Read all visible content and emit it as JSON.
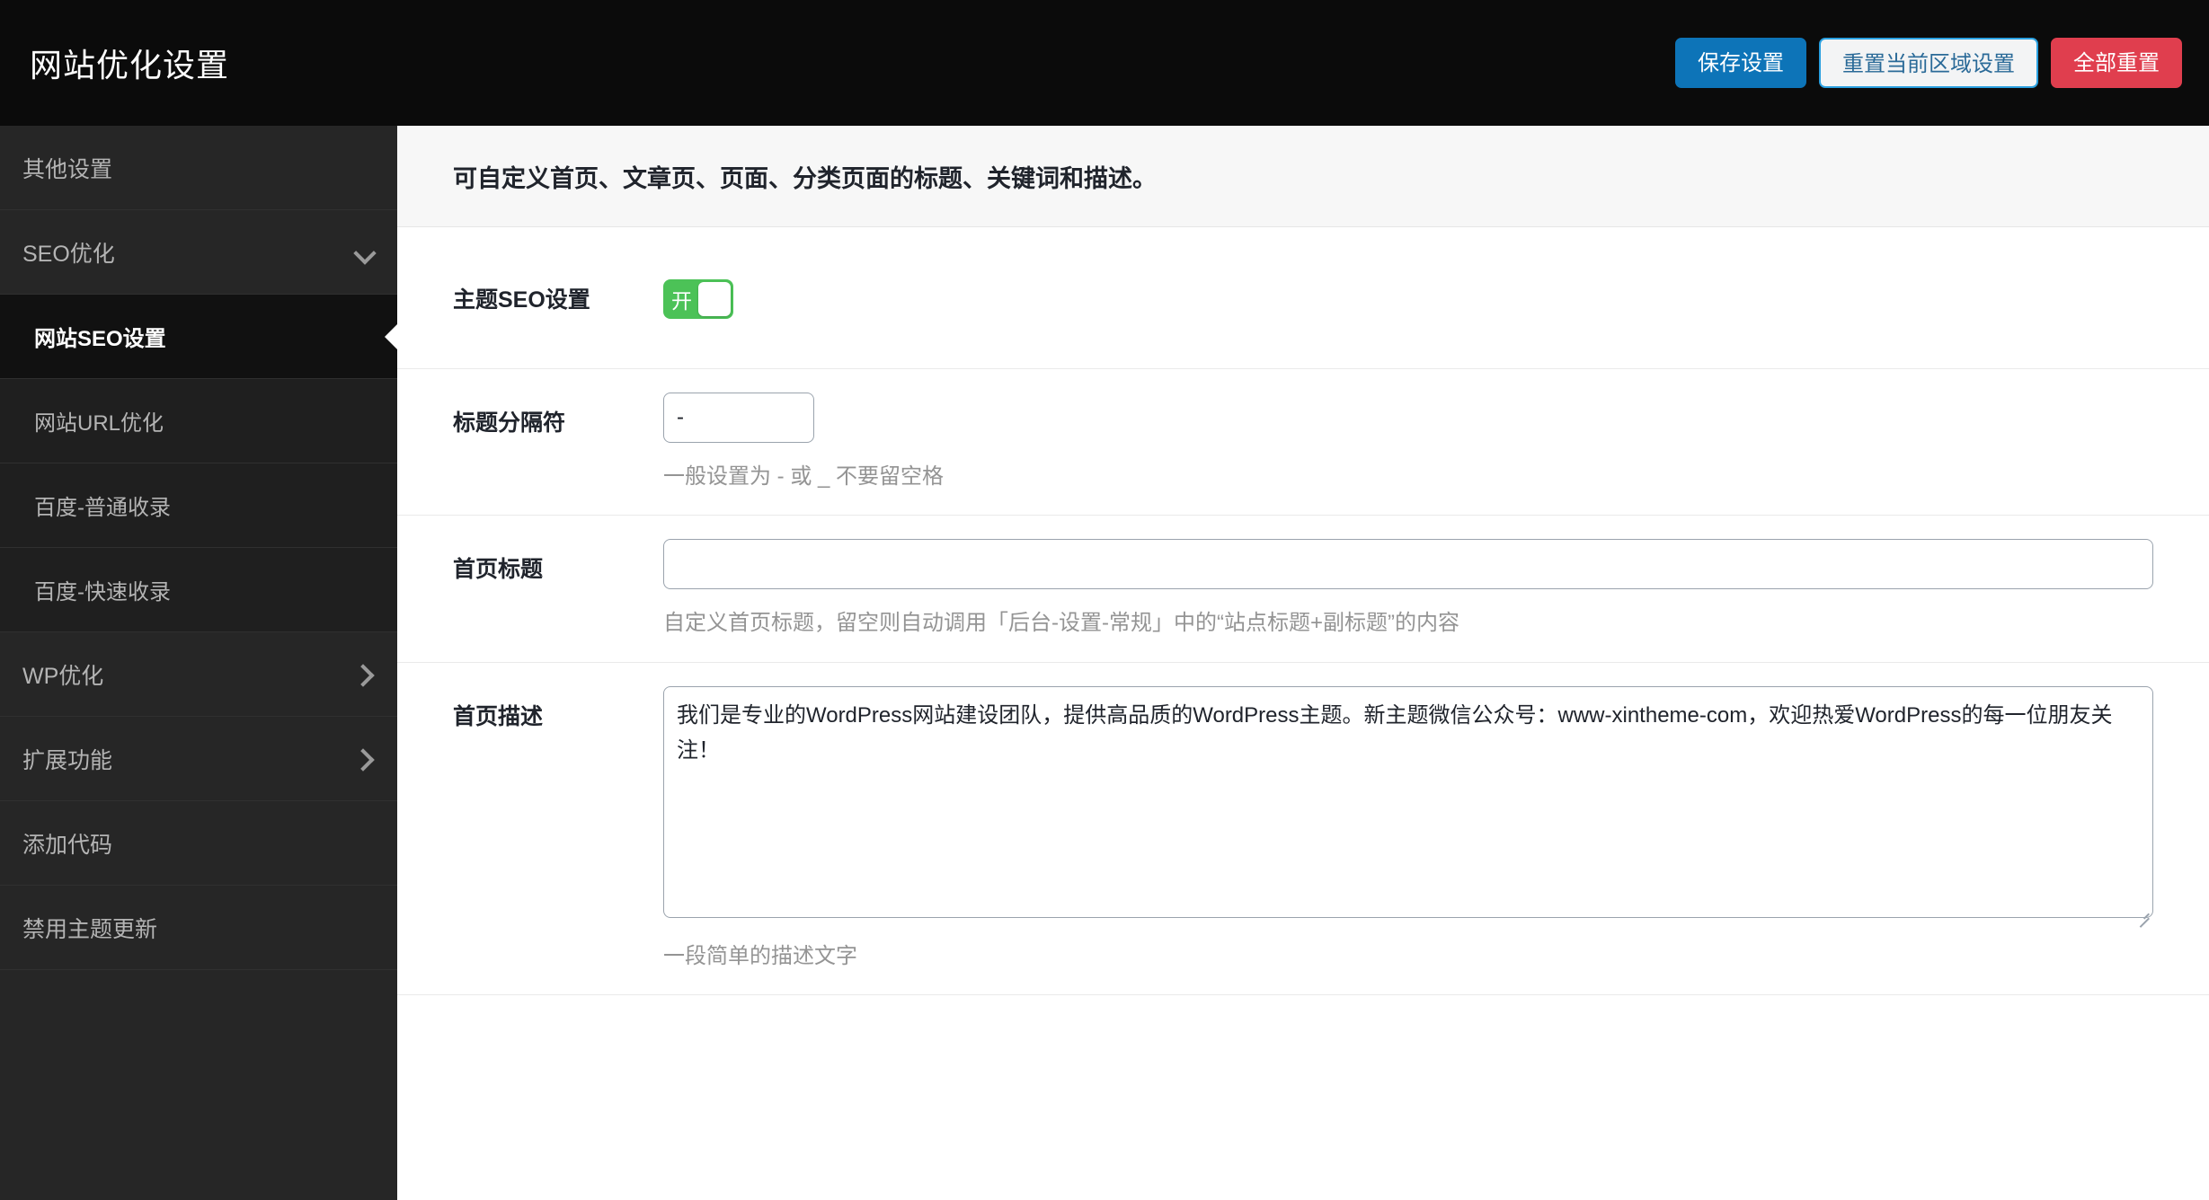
{
  "topbar": {
    "title": "网站优化设置",
    "buttons": [
      {
        "label": "保存设置",
        "style": "primary"
      },
      {
        "label": "重置当前区域设置",
        "style": "outline"
      },
      {
        "label": "全部重置",
        "style": "danger"
      }
    ]
  },
  "sidebar": {
    "items": [
      {
        "label": "其他设置",
        "type": "top",
        "icon": "",
        "active": false
      },
      {
        "label": "SEO优化",
        "type": "top",
        "icon": "chevron-down-icon",
        "active": false
      },
      {
        "label": "网站SEO设置",
        "type": "sub",
        "icon": "",
        "active": true
      },
      {
        "label": "网站URL优化",
        "type": "sub",
        "icon": "",
        "active": false
      },
      {
        "label": "百度-普通收录",
        "type": "sub",
        "icon": "",
        "active": false
      },
      {
        "label": "百度-快速收录",
        "type": "sub",
        "icon": "",
        "active": false
      },
      {
        "label": "WP优化",
        "type": "top",
        "icon": "chevron-right-icon",
        "active": false
      },
      {
        "label": "扩展功能",
        "type": "top",
        "icon": "chevron-right-icon",
        "active": false
      },
      {
        "label": "添加代码",
        "type": "top",
        "icon": "",
        "active": false
      },
      {
        "label": "禁用主题更新",
        "type": "top",
        "icon": "",
        "active": false
      }
    ]
  },
  "panel": {
    "header": "可自定义首页、文章页、页面、分类页面的标题、关键词和描述。",
    "rows": {
      "seo_toggle": {
        "label": "主题SEO设置",
        "toggle_state": "开"
      },
      "separator": {
        "label": "标题分隔符",
        "value": "-",
        "placeholder": "",
        "hint": "一般设置为 - 或 _ 不要留空格"
      },
      "home_title": {
        "label": "首页标题",
        "value": "",
        "placeholder": "",
        "hint": "自定义首页标题，留空则自动调用「后台-设置-常规」中的“站点标题+副标题”的内容"
      },
      "home_description": {
        "label": "首页描述",
        "value": "我们是专业的WordPress网站建设团队，提供高品质的WordPress主题。新主题微信公众号：www-xintheme-com，欢迎热爱WordPress的每一位朋友关注！",
        "placeholder": "",
        "hint": "一段简单的描述文字"
      }
    }
  },
  "colors": {
    "topbar_bg": "#0b0b0b",
    "sidebar_bg": "#262626",
    "sidebar_sub_bg": "#1f1f1f",
    "sidebar_active_bg": "#111111",
    "primary": "#0d74b8",
    "danger": "#e03e4e",
    "toggle_on": "#4cc257",
    "panel_header_bg": "#f7f7f7"
  }
}
